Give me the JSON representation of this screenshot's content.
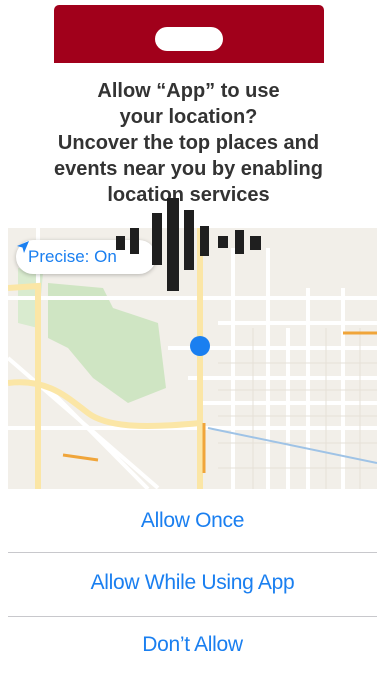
{
  "dialog": {
    "title_lines": [
      "Allow “App” to use",
      "your location?",
      "Uncover the top places and",
      "events near you by enabling",
      "location services"
    ]
  },
  "map": {
    "precise_label": "Precise: On"
  },
  "buttons": {
    "allow_once": "Allow Once",
    "allow_while_using": "Allow While Using App",
    "dont_allow": "Don’t Allow"
  },
  "colors": {
    "accent": "#1a7ff0",
    "brand": "#a1001b",
    "map_bg": "#f2efe9",
    "park": "#cfe5c3"
  },
  "icons": {
    "location_arrow": "location-arrow-icon",
    "voice": "voice-waveform-icon"
  }
}
